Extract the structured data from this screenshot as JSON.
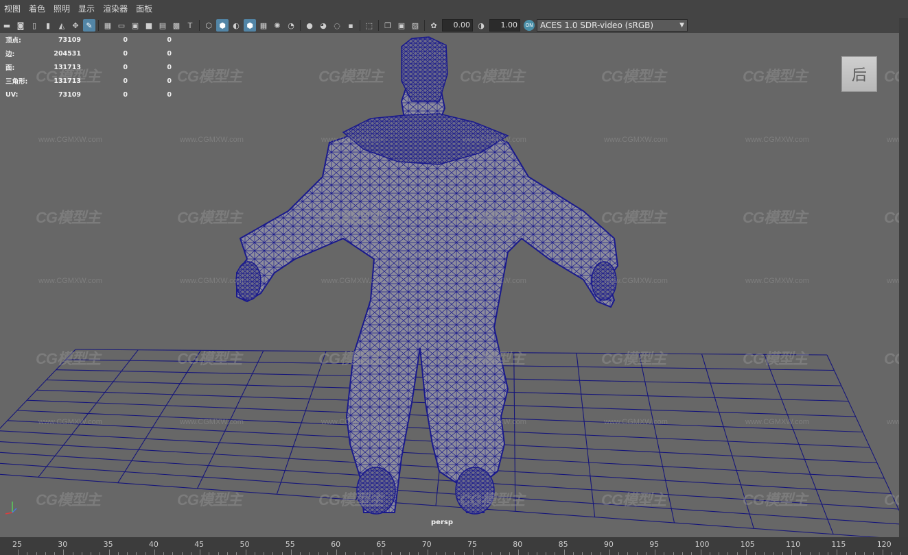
{
  "menu": [
    "视图",
    "着色",
    "照明",
    "显示",
    "渲染器",
    "面板"
  ],
  "toolbar": {
    "exposure": "0.00",
    "gamma": "1.00",
    "colorspace_badge": "ON",
    "colorspace": "ACES 1.0 SDR-video (sRGB)"
  },
  "hud": {
    "rows": [
      {
        "label": "顶点:",
        "v1": "73109",
        "v2": "0",
        "v3": "0"
      },
      {
        "label": "边:",
        "v1": "204531",
        "v2": "0",
        "v3": "0"
      },
      {
        "label": "面:",
        "v1": "131713",
        "v2": "0",
        "v3": "0"
      },
      {
        "label": "三角形:",
        "v1": "131713",
        "v2": "0",
        "v3": "0"
      },
      {
        "label": "UV:",
        "v1": "73109",
        "v2": "0",
        "v3": "0"
      }
    ]
  },
  "viewcube_label": "后",
  "camera": "persp",
  "watermark": {
    "logo": "CG模型主",
    "url": "www.CGMXW.com"
  },
  "timeline": {
    "labels": [
      "25",
      "30",
      "35",
      "40",
      "45",
      "50",
      "55",
      "60",
      "65",
      "70",
      "75",
      "80",
      "85",
      "90",
      "95",
      "100",
      "105",
      "110",
      "115",
      "120"
    ]
  },
  "colors": {
    "wireframe": "#1a1a8c",
    "grid": "#15157a",
    "viewport_bg": "#676767"
  }
}
